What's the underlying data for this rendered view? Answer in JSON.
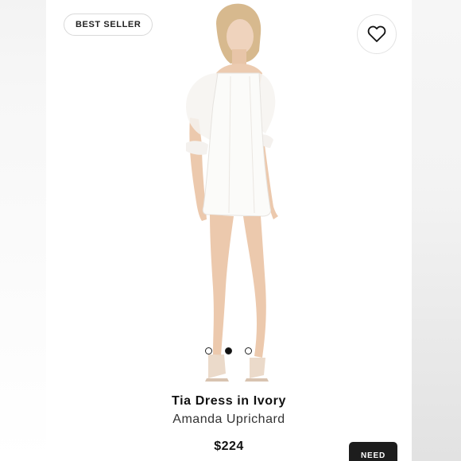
{
  "badge": {
    "label": "BEST SELLER"
  },
  "wishlist": {
    "icon": "heart-icon"
  },
  "carousel": {
    "count": 3,
    "active_index": 1
  },
  "product": {
    "name": "Tia Dress in Ivory",
    "brand": "Amanda Uprichard",
    "price": "$224"
  },
  "cta": {
    "label": "NEED"
  },
  "colors": {
    "accent": "#111111",
    "badge_border": "#d9d9d9",
    "dress": "#fbfbf9"
  }
}
